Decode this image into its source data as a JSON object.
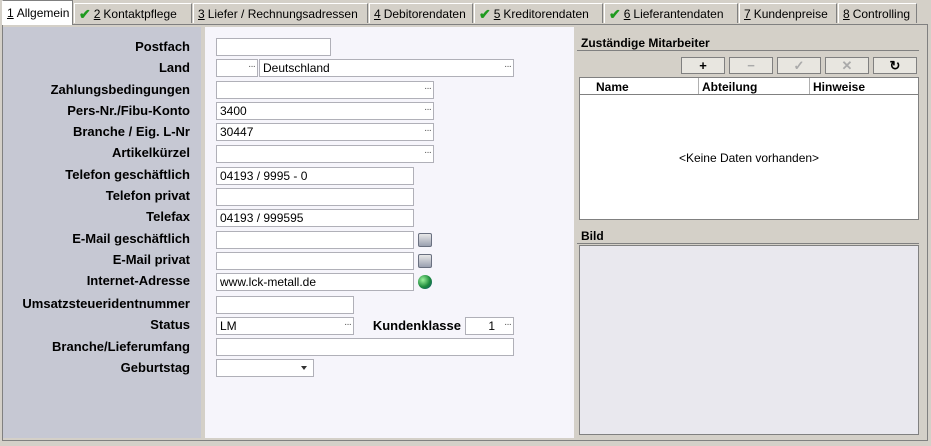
{
  "tabs": [
    {
      "num": "1",
      "label": "Allgemein",
      "checked": false,
      "active": true
    },
    {
      "num": "2",
      "label": "Kontaktpflege",
      "checked": true,
      "active": false
    },
    {
      "num": "3",
      "label": "Liefer / Rechnungsadressen",
      "checked": false,
      "active": false
    },
    {
      "num": "4",
      "label": "Debitorendaten",
      "checked": false,
      "active": false
    },
    {
      "num": "5",
      "label": "Kreditorendaten",
      "checked": true,
      "active": false
    },
    {
      "num": "6",
      "label": "Lieferantendaten",
      "checked": true,
      "active": false
    },
    {
      "num": "7",
      "label": "Kundenpreise",
      "checked": false,
      "active": false
    },
    {
      "num": "8",
      "label": "Controlling",
      "checked": false,
      "active": false
    }
  ],
  "labels": {
    "postfach": "Postfach",
    "land": "Land",
    "zahlungsbedingungen": "Zahlungsbedingungen",
    "pers_nr": "Pers-Nr./Fibu-Konto",
    "branche": "Branche / Eig. L-Nr",
    "artikelkuerzel": "Artikelkürzel",
    "telefon_geschaeftlich": "Telefon geschäftlich",
    "telefon_privat": "Telefon privat",
    "telefax": "Telefax",
    "email_geschaeftlich": "E-Mail geschäftlich",
    "email_privat": "E-Mail privat",
    "internet": "Internet-Adresse",
    "ust_id": "Umsatzsteueridentnummer",
    "status": "Status",
    "kundenklasse": "Kundenklasse",
    "branche_lieferumfang": "Branche/Lieferumfang",
    "geburtstag": "Geburtstag"
  },
  "values": {
    "postfach": "",
    "land_code": "",
    "land": "Deutschland",
    "zahlungsbedingungen": "",
    "pers_nr": "3400",
    "branche": "30447",
    "artikelkuerzel": "",
    "telefon_geschaeftlich": "04193 / 9995 - 0",
    "telefon_privat": "",
    "telefax": "04193 / 999595",
    "email_geschaeftlich": "",
    "email_privat": "",
    "internet": "www.lck-metall.de",
    "ust_id": "",
    "status": "LM",
    "kundenklasse": "1",
    "branche_lieferumfang": "",
    "geburtstag": ""
  },
  "ellipsis": "···",
  "mitarbeiter": {
    "title": "Zuständige Mitarbeiter",
    "buttons": {
      "add": "+",
      "remove": "−",
      "confirm": "✓",
      "cancel": "✕",
      "refresh": "↻"
    },
    "columns": [
      "Name",
      "Abteilung",
      "Hinweise"
    ],
    "empty": "<Keine Daten vorhanden>"
  },
  "bild": {
    "title": "Bild"
  }
}
